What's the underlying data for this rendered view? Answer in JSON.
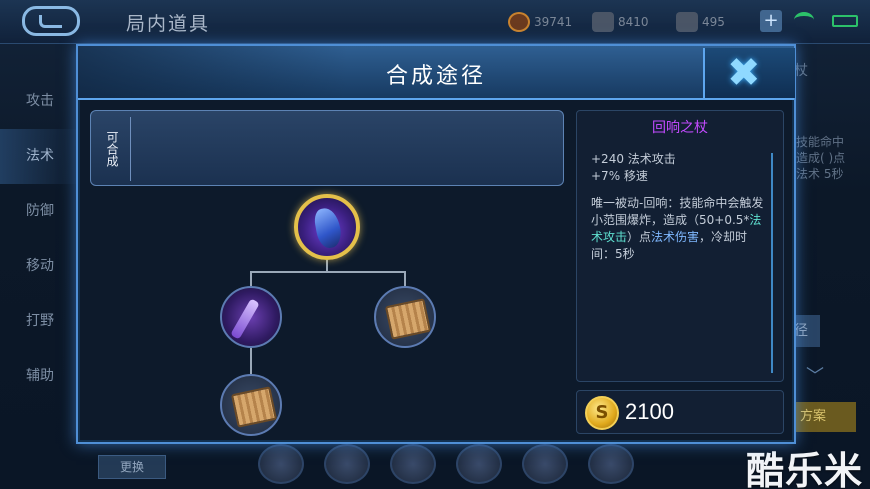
{
  "header": {
    "title": "局内道具",
    "gold": "39741",
    "diamonds": "8410",
    "vouchers": "495"
  },
  "left_menu": [
    "攻击",
    "法术",
    "防御",
    "移动",
    "打野",
    "辅助"
  ],
  "right_ghost": {
    "title": "杖",
    "desc": "技能命中 造成( )点法术 5秒",
    "btn": "径",
    "plan": "方案"
  },
  "replace_button": "更换",
  "watermark": "酷乐米",
  "modal": {
    "title": "合成途径",
    "combinable_label": "可合成",
    "item": {
      "name": "回响之杖",
      "stat1": "+240 法术攻击",
      "stat2": "+7% 移速",
      "passive_a": "唯一被动-回响：技能命中会触发小范围爆炸，造成（50+0.5*",
      "passive_b": "法术攻击",
      "passive_c": "）点",
      "passive_d": "法术伤害",
      "passive_e": "，冷却时间：5秒",
      "price": "2100"
    },
    "tree": {
      "root": "echo-staff",
      "children": [
        "magic-staff",
        "tome"
      ],
      "grandchildren": [
        "tome"
      ]
    }
  },
  "colors": {
    "item_name": "#c34bff",
    "accent": "#4f8fd6",
    "coin": "#e0a91c"
  }
}
